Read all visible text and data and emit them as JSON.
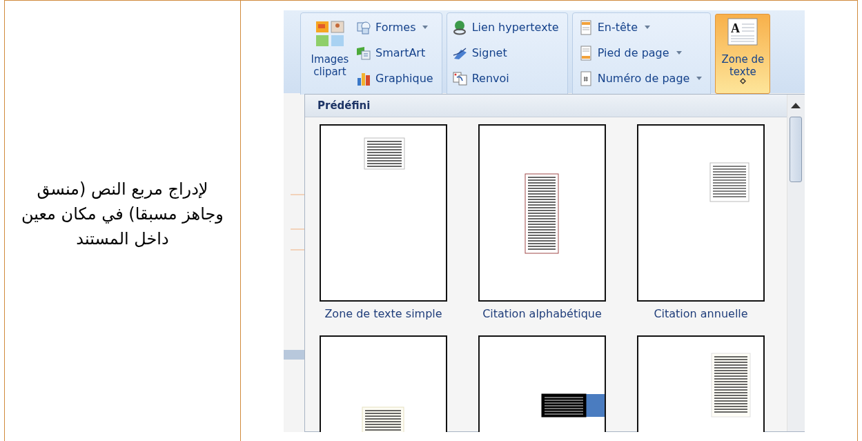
{
  "note": {
    "text": "لإدراج مربع النص (منسق وجاهز مسبقا) في مكان معين داخل المستند"
  },
  "ribbon": {
    "groups": [
      {
        "large": {
          "label": "Images clipart",
          "selected": false,
          "dropdown": false
        },
        "items": [
          {
            "label": "Formes",
            "dropdown": true
          },
          {
            "label": "SmartArt",
            "dropdown": false
          },
          {
            "label": "Graphique",
            "dropdown": false
          }
        ]
      },
      {
        "items": [
          {
            "label": "Lien hypertexte",
            "dropdown": false
          },
          {
            "label": "Signet",
            "dropdown": false
          },
          {
            "label": "Renvoi",
            "dropdown": false
          }
        ]
      },
      {
        "items": [
          {
            "label": "En-tête",
            "dropdown": true
          },
          {
            "label": "Pied de page",
            "dropdown": true
          },
          {
            "label": "Numéro de page",
            "dropdown": true
          }
        ]
      },
      {
        "large": {
          "label": "Zone de texte",
          "selected": true,
          "dropdown": true,
          "glyph": "A"
        }
      }
    ]
  },
  "gallery": {
    "heading": "Prédéfini",
    "items": [
      {
        "label": "Zone de texte simple",
        "kind": "plain"
      },
      {
        "label": "Citation alphabétique",
        "kind": "sidebar"
      },
      {
        "label": "Citation annuelle",
        "kind": "annual"
      },
      {
        "kind": "bracket"
      },
      {
        "kind": "dark"
      },
      {
        "kind": "scroll"
      }
    ]
  }
}
